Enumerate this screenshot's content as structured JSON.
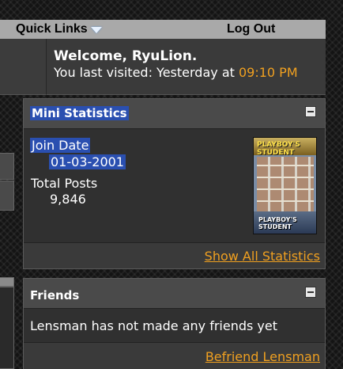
{
  "navbar": {
    "quick_links": "Quick Links",
    "log_out": "Log Out"
  },
  "welcome": {
    "title": "Welcome, RyuLion.",
    "last_visited_prefix": "You last visited: Yesterday at ",
    "last_visited_time": "09:10 PM"
  },
  "mini_statistics": {
    "title": "Mini Statistics",
    "join_date_label": "Join Date",
    "join_date_value": "01-03-2001",
    "total_posts_label": "Total Posts",
    "total_posts_value": "9,846",
    "banner_top_text": "PLAYBOY'S STUDENT",
    "banner_bottom_text": "PLAYBOY'S STUDENT",
    "footer_link": "Show All Statistics"
  },
  "friends": {
    "title": "Friends",
    "empty_message": "Lensman has not made any friends yet",
    "footer_link": "Befriend Lensman"
  },
  "colors": {
    "accent_orange": "#f0a020",
    "selection_blue": "#2a4fb0",
    "navbar_gray": "#a9a9a9"
  },
  "icons": {
    "quick_links": "dropdown-triangle-icon",
    "collapse": "collapse-minus-icon"
  }
}
